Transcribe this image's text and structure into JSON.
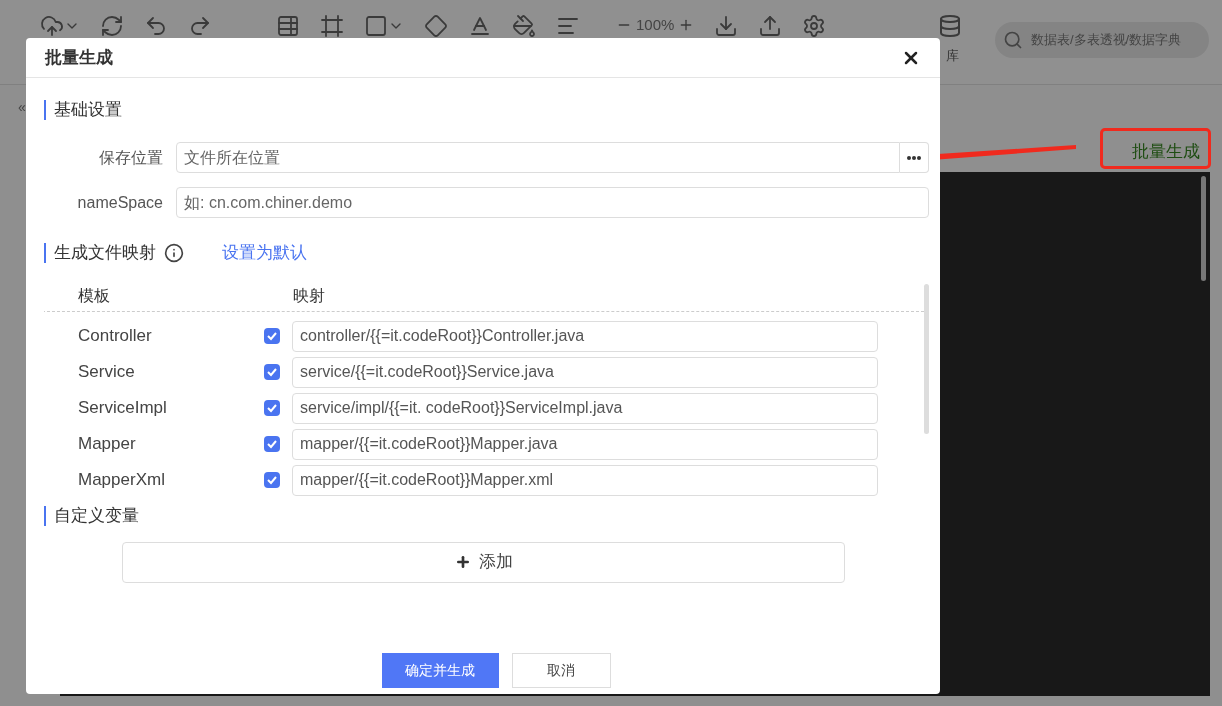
{
  "toolbar": {
    "zoom": "100%",
    "database_label": "库",
    "search": {
      "placeholder": "数据表/多表透视/数据字典"
    }
  },
  "side_toggle": "«",
  "generate_button": "批量生成",
  "dialog": {
    "title": "批量生成",
    "basic_section": {
      "title": "基础设置",
      "fields": [
        {
          "label": "保存位置",
          "placeholder": "文件所在位置",
          "has_browse": true
        },
        {
          "label": "nameSpace",
          "placeholder": "如: cn.com.chiner.demo",
          "has_browse": false
        }
      ]
    },
    "mapping_section": {
      "title": "生成文件映射",
      "link": "设置为默认",
      "columns": [
        "模板",
        "映射"
      ],
      "rows": [
        {
          "template": "Controller",
          "checked": true,
          "mapping": "controller/{{=it.codeRoot}}Controller.java"
        },
        {
          "template": "Service",
          "checked": true,
          "mapping": "service/{{=it.codeRoot}}Service.java"
        },
        {
          "template": "ServiceImpl",
          "checked": true,
          "mapping": "service/impl/{{=it. codeRoot}}ServiceImpl.java"
        },
        {
          "template": "Mapper",
          "checked": true,
          "mapping": "mapper/{{=it.codeRoot}}Mapper.java"
        },
        {
          "template": "MapperXml",
          "checked": true,
          "mapping": "mapper/{{=it.codeRoot}}Mapper.xml"
        }
      ]
    },
    "custom_section": {
      "title": "自定义变量",
      "add_button": "添加"
    },
    "buttons": [
      {
        "label": "确定并生成",
        "kind": "primary"
      },
      {
        "label": "取消",
        "kind": "default"
      }
    ]
  }
}
